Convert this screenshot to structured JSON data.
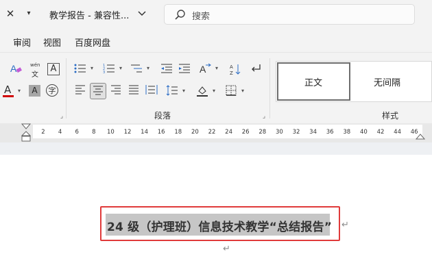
{
  "titlebar": {
    "close_glyph": "✕",
    "quick_access_glyph": "▾",
    "doc_title": "教学报告 - 兼容性...",
    "chevron_glyph": "⌄"
  },
  "search": {
    "placeholder": "搜索"
  },
  "menu": {
    "items": [
      "审阅",
      "视图",
      "百度网盘"
    ]
  },
  "ribbon": {
    "font_group": {
      "phonetic_top": "wén",
      "phonetic_bottom": "文",
      "char_border": "A",
      "font_color_letter": "A",
      "font_color": "#d00000",
      "char_shading": "A",
      "enclosed_char": "字"
    },
    "paragraph_group": {
      "label": "段落"
    },
    "styles_group": {
      "label": "样式",
      "items": [
        "正文",
        "无间隔"
      ]
    }
  },
  "ruler": {
    "ticks": [
      "2",
      "4",
      "6",
      "8",
      "10",
      "12",
      "14",
      "16",
      "18",
      "20",
      "22",
      "24",
      "26",
      "28",
      "30",
      "32",
      "34",
      "36",
      "38",
      "40",
      "42",
      "44",
      "46"
    ]
  },
  "document": {
    "heading": "24 级（护理班）信息技术教学“总结报告”",
    "paragraph_mark": "↵"
  },
  "colors": {
    "highlight_box": "#e03a3a",
    "selection": "#c6c6c6",
    "accent_blue": "#2b6cc4"
  }
}
